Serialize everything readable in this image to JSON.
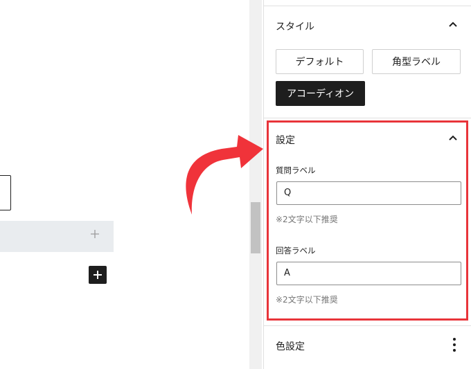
{
  "style_panel": {
    "title": "スタイル",
    "buttons": [
      "デフォルト",
      "角型ラベル",
      "アコーディオン"
    ],
    "active_index": 2
  },
  "settings_panel": {
    "title": "設定",
    "question_label": {
      "label": "質問ラベル",
      "value": "Q",
      "help": "※2文字以下推奨"
    },
    "answer_label": {
      "label": "回答ラベル",
      "value": "A",
      "help": "※2文字以下推奨"
    }
  },
  "color_panel": {
    "title": "色設定"
  },
  "colors": {
    "highlight": "#e8343a",
    "arrow": "#f0333a",
    "active_button": "#1e1e1e"
  },
  "icons": [
    "chevron-up-icon",
    "plus-icon",
    "more-vertical-icon",
    "curved-arrow-icon"
  ]
}
